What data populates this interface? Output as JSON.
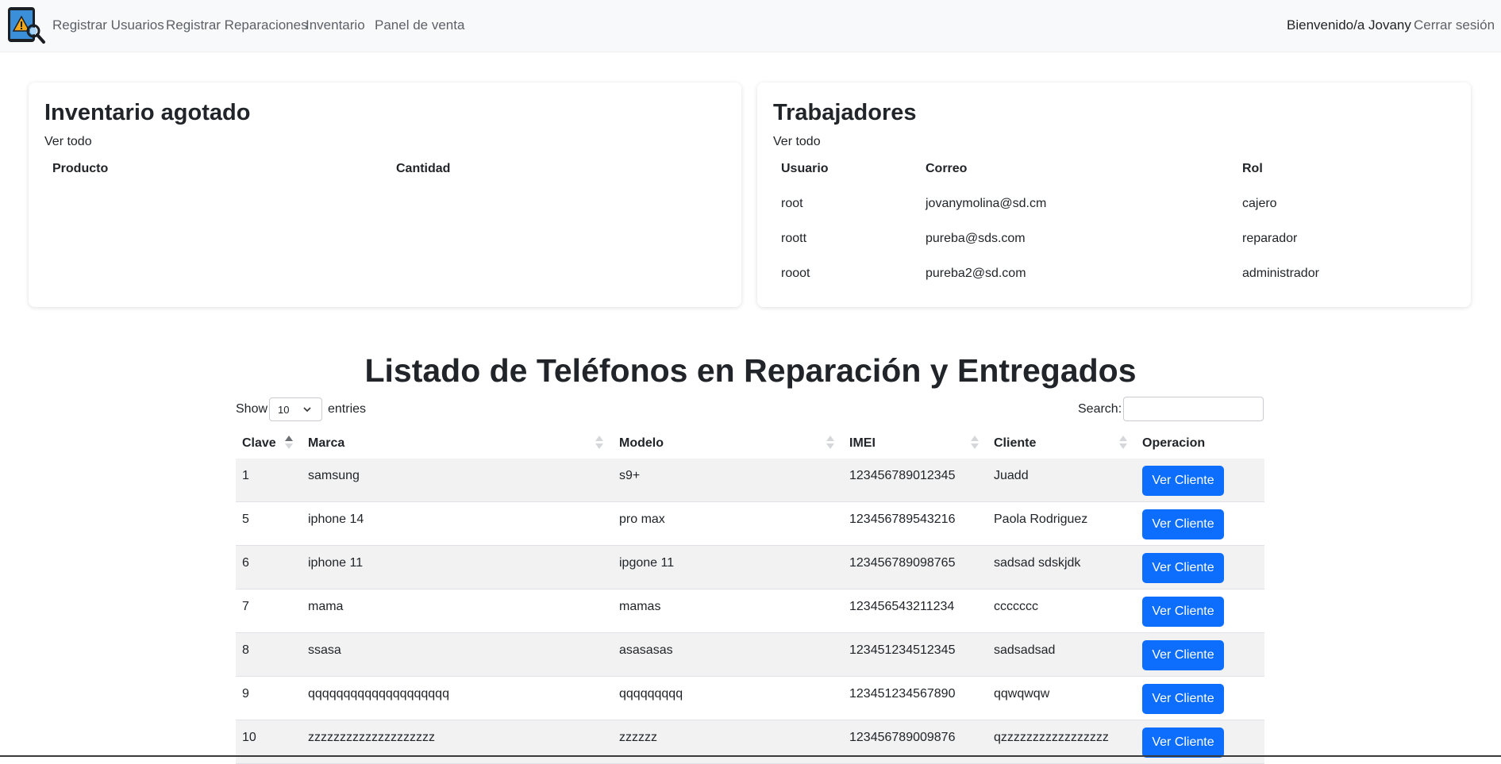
{
  "nav": {
    "links": [
      "Registrar Usuarios",
      "Registrar Reparaciones",
      "Inventario",
      "Panel de venta"
    ],
    "welcome": "Bienvenido/a Jovany",
    "logout": "Cerrar sesión",
    "logo_icon": "phone-repair-logo-icon"
  },
  "inventory_card": {
    "title": "Inventario agotado",
    "view_all": "Ver todo",
    "headers": [
      "Producto",
      "Cantidad"
    ]
  },
  "workers_card": {
    "title": "Trabajadores",
    "view_all": "Ver todo",
    "headers": [
      "Usuario",
      "Correo",
      "Rol"
    ],
    "rows": [
      [
        "root",
        "jovanymolina@sd.cm",
        "cajero"
      ],
      [
        "roott",
        "pureba@sds.com",
        "reparador"
      ],
      [
        "rooot",
        "pureba2@sd.com",
        "administrador"
      ]
    ]
  },
  "phones": {
    "title": "Listado de Teléfonos en Reparación y Entregados",
    "show_label": "Show",
    "entries_label": "entries",
    "page_size": "10",
    "search_label": "Search:",
    "search_value": "",
    "headers": [
      "Clave",
      "Marca",
      "Modelo",
      "IMEI",
      "Cliente",
      "Operacion"
    ],
    "button_label": "Ver Cliente",
    "rows": [
      [
        "1",
        "samsung",
        "s9+",
        "123456789012345",
        "Juadd"
      ],
      [
        "5",
        "iphone 14",
        "pro max",
        "123456789543216",
        "Paola Rodriguez"
      ],
      [
        "6",
        "iphone 11",
        "ipgone 11",
        "123456789098765",
        "sadsad sdskjdk"
      ],
      [
        "7",
        "mama",
        "mamas",
        "123456543211234",
        "ccccccc"
      ],
      [
        "8",
        "ssasa",
        "asasasas",
        "123451234512345",
        "sadsadsad"
      ],
      [
        "9",
        "qqqqqqqqqqqqqqqqqqqq",
        "qqqqqqqqq",
        "123451234567890",
        "qqwqwqw"
      ],
      [
        "10",
        "zzzzzzzzzzzzzzzzzzzz",
        "zzzzzz",
        "123456789009876",
        "qzzzzzzzzzzzzzzzzz"
      ]
    ]
  },
  "colors": {
    "primary": "#0d6efd",
    "navbar_bg": "#f8f9fa",
    "stripe": "#f2f2f2"
  }
}
